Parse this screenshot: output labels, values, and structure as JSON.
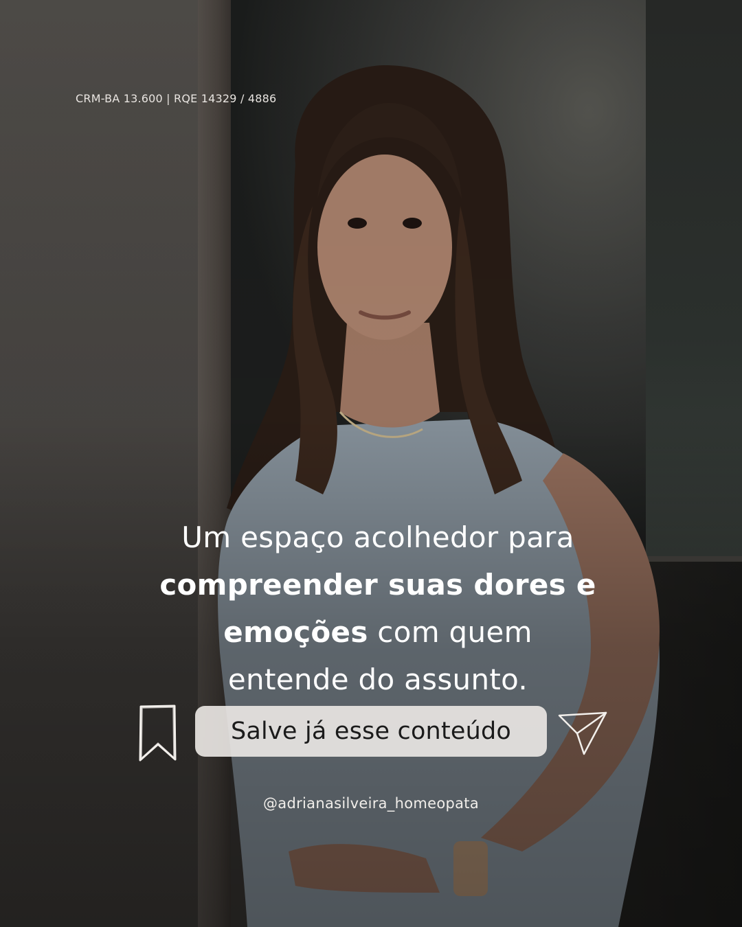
{
  "registro": "CRM-BA 13.600 | RQE 14329 / 4886",
  "headline": {
    "line1": "Um espaço acolhedor para",
    "line2_bold": "compreender suas dores e",
    "line3_bold": "emoções",
    "line3_regular": " com quem",
    "line4": "entende do assunto."
  },
  "cta": {
    "label": "Salve já esse conteúdo",
    "icons": [
      "bookmark-icon",
      "send-icon"
    ]
  },
  "handle": "@adrianasilveira_homeopata",
  "colors": {
    "text": "#ffffff",
    "pill_background": "#ece9e6",
    "pill_text": "#1b1b1b"
  }
}
